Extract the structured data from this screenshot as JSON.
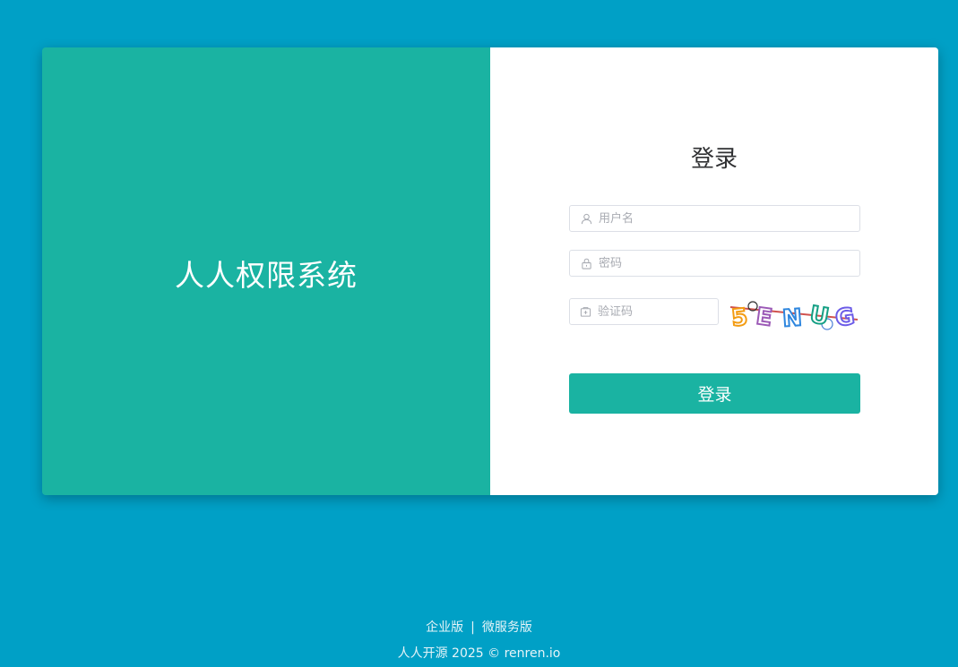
{
  "left_panel": {
    "system_title": "人人权限系统"
  },
  "login_form": {
    "title": "登录",
    "username": {
      "placeholder": "用户名",
      "value": "",
      "icon": "user-icon"
    },
    "password": {
      "placeholder": "密码",
      "value": "",
      "icon": "lock-icon"
    },
    "captcha": {
      "placeholder": "验证码",
      "value": "",
      "icon": "captcha-icon",
      "image_text": "5ENUG"
    },
    "submit_label": "登录"
  },
  "footer": {
    "links": [
      "企业版",
      "微服务版"
    ],
    "separator": "|",
    "copyright": "人人开源 2025 © renren.io"
  },
  "colors": {
    "background": "#00a0c6",
    "accent": "#1ab3a2",
    "panel": "#ffffff"
  }
}
